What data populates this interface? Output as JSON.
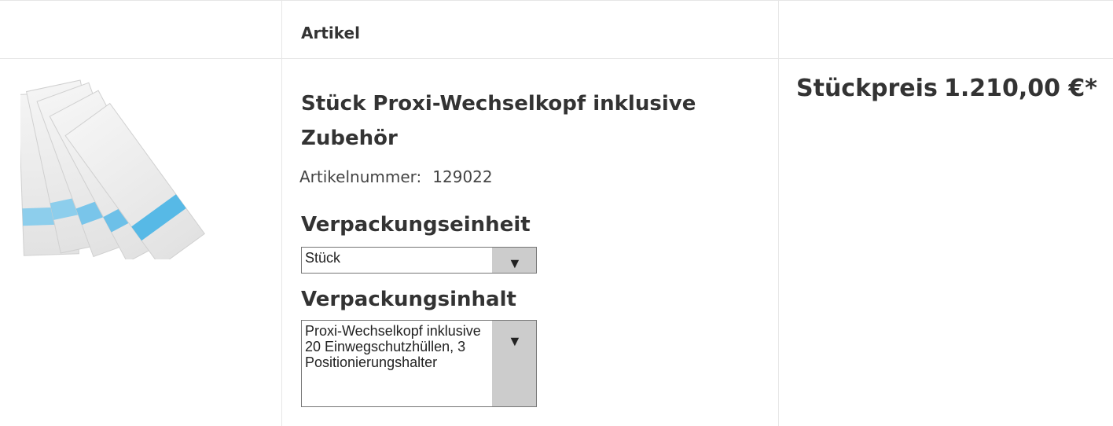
{
  "columns": {
    "article": "Artikel",
    "unit_price": "Stückpreis"
  },
  "product": {
    "image_icon": "product-photo",
    "title": "Stück Proxi-Wechselkopf inklusive Zubehör",
    "sku_label": "Artikelnummer:",
    "sku_value": "129022",
    "price": "1.210,00 €*"
  },
  "options": {
    "unit": {
      "label": "Verpackungseinheit",
      "selected": "Stück"
    },
    "content": {
      "label": "Verpackungsinhalt",
      "selected": "Proxi-Wechselkopf inklusive 20 Einwegschutzhüllen, 3 Positionierungshalter"
    }
  },
  "icons": {
    "dropdown": "triangle-down-icon"
  },
  "colors": {
    "border": "#e6e6e6",
    "select_arrow_bg": "#cccccc",
    "text": "#333333",
    "accent_blue": "#4fb6e6"
  }
}
